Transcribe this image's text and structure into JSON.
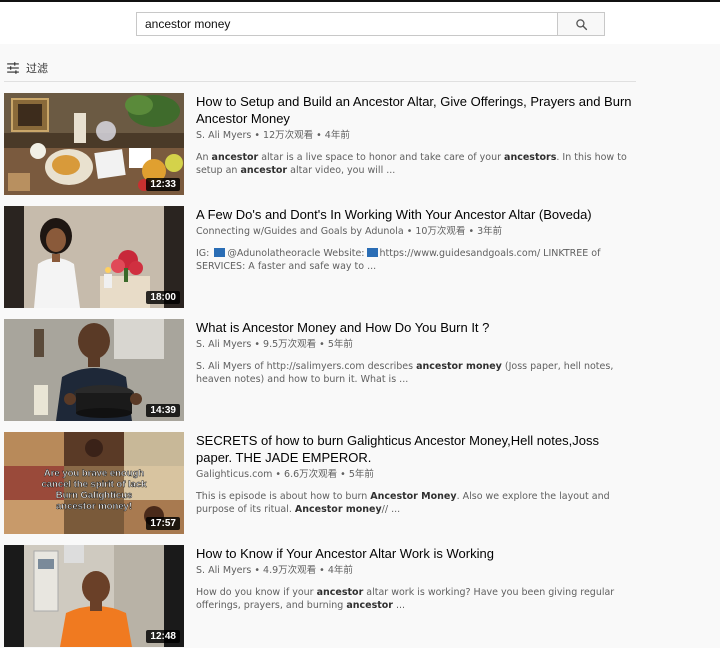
{
  "search": {
    "query": "ancestor money"
  },
  "filter": {
    "label": "过滤"
  },
  "results": [
    {
      "title": "How to Setup and Build an Ancestor Altar, Give Offerings, Prayers and Burn Ancestor Money",
      "channel": "S. Ali Myers",
      "views": "12万次观看",
      "age": "4年前",
      "duration": "12:33",
      "desc": [
        {
          "t": "An ",
          "b": false
        },
        {
          "t": "ancestor",
          "b": true
        },
        {
          "t": " altar is a live space to honor and take care of your ",
          "b": false
        },
        {
          "t": "ancestors",
          "b": true
        },
        {
          "t": ". In this how to setup an ",
          "b": false
        },
        {
          "t": "ancestor",
          "b": true
        },
        {
          "t": " altar video, you will ...",
          "b": false
        }
      ]
    },
    {
      "title": "A Few Do's and Dont's In Working With Your Ancestor Altar (Boveda)",
      "channel": "Connecting w/Guides and Goals by Adunola",
      "views": "10万次观看",
      "age": "3年前",
      "duration": "18:00",
      "desc": [
        {
          "t": "IG: ",
          "b": false
        },
        {
          "icon": true
        },
        {
          "t": "@Adunolatheoracle Website:",
          "b": false
        },
        {
          "icon": true
        },
        {
          "t": "https://www.guidesandgoals.com/ LINKTREE of SERVICES: A faster and safe way to ...",
          "b": false
        }
      ]
    },
    {
      "title": "What is Ancestor Money and How Do You Burn It ?",
      "channel": "S. Ali Myers",
      "views": "9.5万次观看",
      "age": "5年前",
      "duration": "14:39",
      "desc": [
        {
          "t": "S. Ali Myers of http://salimyers.com describes ",
          "b": false
        },
        {
          "t": "ancestor money",
          "b": true
        },
        {
          "t": " (Joss paper, hell notes, heaven notes) and how to burn it. What is ...",
          "b": false
        }
      ]
    },
    {
      "title": "SECRETS of how to burn Galighticus Ancestor Money,Hell notes,Joss paper. THE JADE EMPEROR.",
      "channel": "Galighticus.com",
      "views": "6.6万次观看",
      "age": "5年前",
      "duration": "17:57",
      "thumb_text": [
        "Are you brave enough",
        "cancel the spirit of lack",
        "Burn Galighticus",
        "ancestor money!"
      ],
      "desc": [
        {
          "t": "This is episode is about how to burn ",
          "b": false
        },
        {
          "t": "Ancestor Money",
          "b": true
        },
        {
          "t": ". Also we explore the layout and purpose of its ritual. ",
          "b": false
        },
        {
          "t": "Ancestor money",
          "b": true
        },
        {
          "t": "// ...",
          "b": false
        }
      ]
    },
    {
      "title": "How to Know if Your Ancestor Altar Work is Working",
      "channel": "S. Ali Myers",
      "views": "4.9万次观看",
      "age": "4年前",
      "duration": "12:48",
      "desc": [
        {
          "t": "How do you know if your ",
          "b": false
        },
        {
          "t": "ancestor",
          "b": true
        },
        {
          "t": " altar work is working? Have you been giving regular offerings, prayers, and burning ",
          "b": false
        },
        {
          "t": "ancestor",
          "b": true
        },
        {
          "t": " ...",
          "b": false
        }
      ]
    }
  ]
}
